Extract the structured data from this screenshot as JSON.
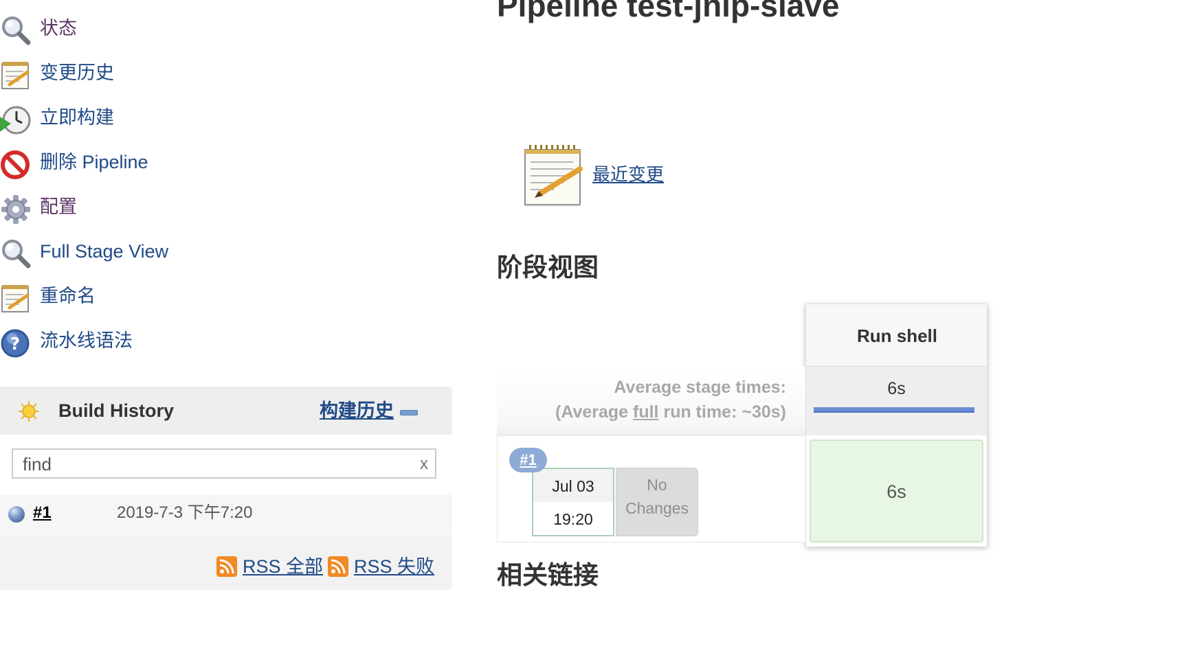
{
  "page": {
    "title": "Pipeline test-jnlp-slave"
  },
  "sidebar": {
    "items": [
      {
        "label": "状态",
        "icon": "search-icon",
        "visited": true
      },
      {
        "label": "变更历史",
        "icon": "notepad-icon",
        "visited": false
      },
      {
        "label": "立即构建",
        "icon": "clock-icon",
        "visited": false
      },
      {
        "label": "删除 Pipeline",
        "icon": "no-entry-icon",
        "visited": false
      },
      {
        "label": "配置",
        "icon": "gear-icon",
        "visited": true
      },
      {
        "label": "Full Stage View",
        "icon": "search-icon",
        "visited": false
      },
      {
        "label": "重命名",
        "icon": "notepad-icon",
        "visited": false
      },
      {
        "label": "流水线语法",
        "icon": "help-icon",
        "visited": false
      }
    ]
  },
  "build_history": {
    "title": "Build History",
    "link_label": "构建历史",
    "search_placeholder": "find",
    "clear_label": "x",
    "builds": [
      {
        "number": "#1",
        "date": "2019-7-3 下午7:20"
      }
    ],
    "rss_all": "RSS 全部",
    "rss_failed": "RSS 失败"
  },
  "main": {
    "recent_changes_label": "最近变更",
    "stage_view_heading": "阶段视图",
    "related_links_heading": "相关链接"
  },
  "stage_view": {
    "stages": [
      {
        "name": "Run shell"
      }
    ],
    "avg_label": "Average stage times:",
    "avg_full_prefix": "(Average ",
    "avg_full_word": "full",
    "avg_full_suffix": " run time: ~30s)",
    "avg_times": [
      "6s"
    ],
    "runs": [
      {
        "badge": "#1",
        "date": "Jul 03",
        "time": "19:20",
        "changes_line1": "No",
        "changes_line2": "Changes",
        "stage_times": [
          "6s"
        ],
        "status": "success"
      }
    ]
  },
  "colors": {
    "link": "#204a87",
    "visited_link": "#5c3566",
    "success_cell": "#e8f6e4",
    "avg_bar": "#6a8ed4",
    "badge": "#8eabd6"
  }
}
